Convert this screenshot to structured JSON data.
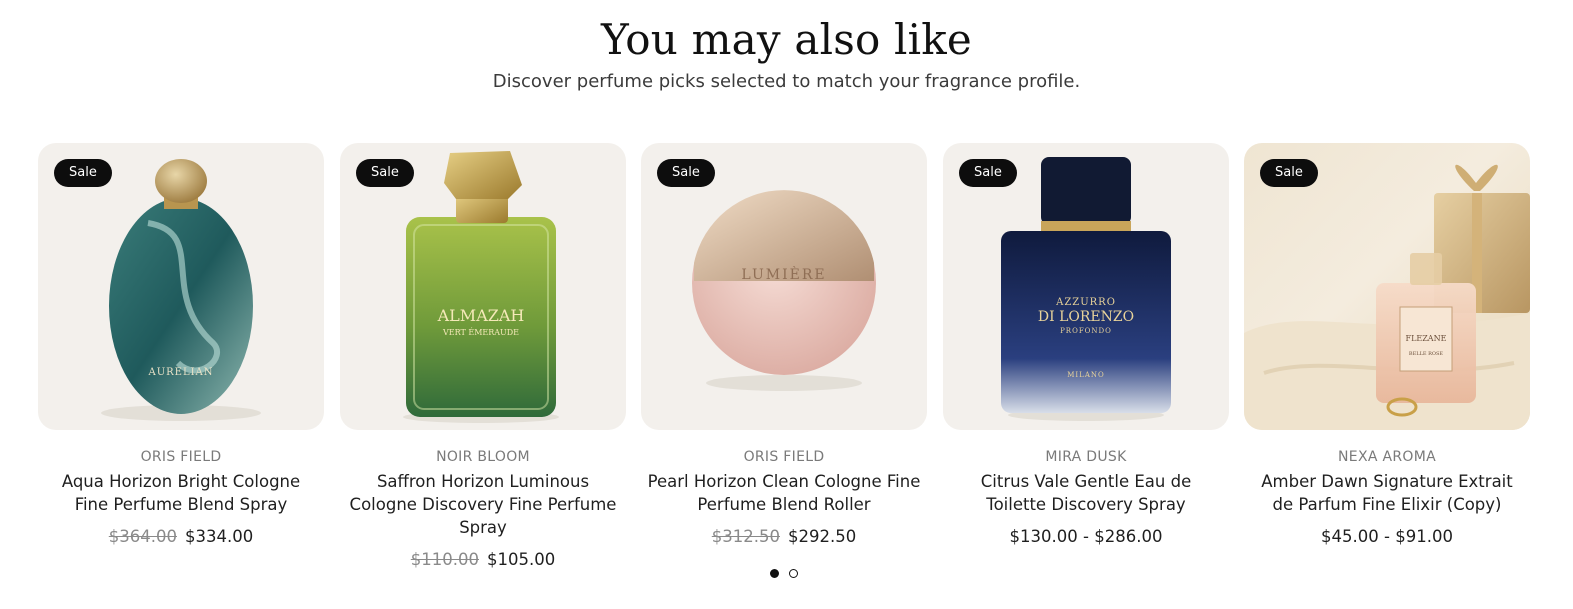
{
  "section": {
    "heading": "You may also like",
    "subheading": "Discover perfume picks selected to match your fragrance profile."
  },
  "products": [
    {
      "badge": "Sale",
      "vendor": "ORIS FIELD",
      "title": "Aqua Horizon Bright Cologne Fine Perfume Blend Spray",
      "compare_price": "$364.00",
      "price": "$334.00",
      "bottle_text": "AURELIAN"
    },
    {
      "badge": "Sale",
      "vendor": "NOIR BLOOM",
      "title": "Saffron Horizon Luminous Cologne Discovery Fine Perfume Spray",
      "compare_price": "$110.00",
      "price": "$105.00",
      "bottle_text": "ALMAZAH",
      "bottle_subtext": "VERT ÉMERAUDE"
    },
    {
      "badge": "Sale",
      "vendor": "ORIS FIELD",
      "title": "Pearl Horizon Clean Cologne Fine Perfume Blend Roller",
      "compare_price": "$312.50",
      "price": "$292.50",
      "bottle_text": "LUMIÈRE"
    },
    {
      "badge": "Sale",
      "vendor": "MIRA DUSK",
      "title": "Citrus Vale Gentle Eau de Toilette Discovery Spray",
      "compare_price": "",
      "price": "$130.00 - $286.00",
      "bottle_text": "AZZURRO",
      "bottle_subtext": "DI LORENZO",
      "bottle_subtext2": "PROFONDO",
      "bottle_subtext3": "MILANO"
    },
    {
      "badge": "Sale",
      "vendor": "NEXA AROMA",
      "title": "Amber Dawn Signature Extrait de Parfum Fine Elixir (Copy)",
      "compare_price": "",
      "price": "$45.00 - $91.00",
      "bottle_text": "FLEZANE",
      "bottle_subtext": "BELLE ROSE"
    }
  ],
  "pagination": {
    "pages": 2,
    "active": 1
  },
  "colors": {
    "badge_bg": "#0d0d0d",
    "card_bg": "#f3f0ec",
    "compare_price": "#8a8a8a"
  }
}
